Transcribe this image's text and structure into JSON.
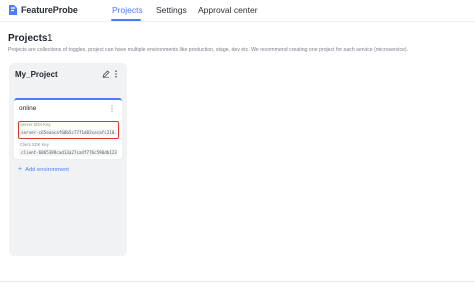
{
  "brand": {
    "name": "FeatureProbe",
    "accent": "#4e7cf6"
  },
  "nav": {
    "tabs": [
      {
        "label": "Projects",
        "active": true
      },
      {
        "label": "Settings",
        "active": false
      },
      {
        "label": "Approval center",
        "active": false
      }
    ]
  },
  "page": {
    "title": "Projects",
    "count": "1",
    "description": "Projects are collections of toggles, project can have multiple environments like production, stage, dev etc. We recommend creating one project for each service (microservice)."
  },
  "project": {
    "name": "My_Project",
    "environment": {
      "name": "online",
      "server_sdk_label": "Server SDK Key",
      "server_sdk_key": "server-c65eaacaf60b5c77f1d03cecafc210...",
      "client_sdk_label": "Client SDK Key",
      "client_sdk_key": "client-6065389cad13a27ca4f776c590db123..."
    },
    "add_environment_label": "Add environment"
  },
  "colors": {
    "highlight": "#d9372e",
    "panel": "#f1f2f4"
  }
}
